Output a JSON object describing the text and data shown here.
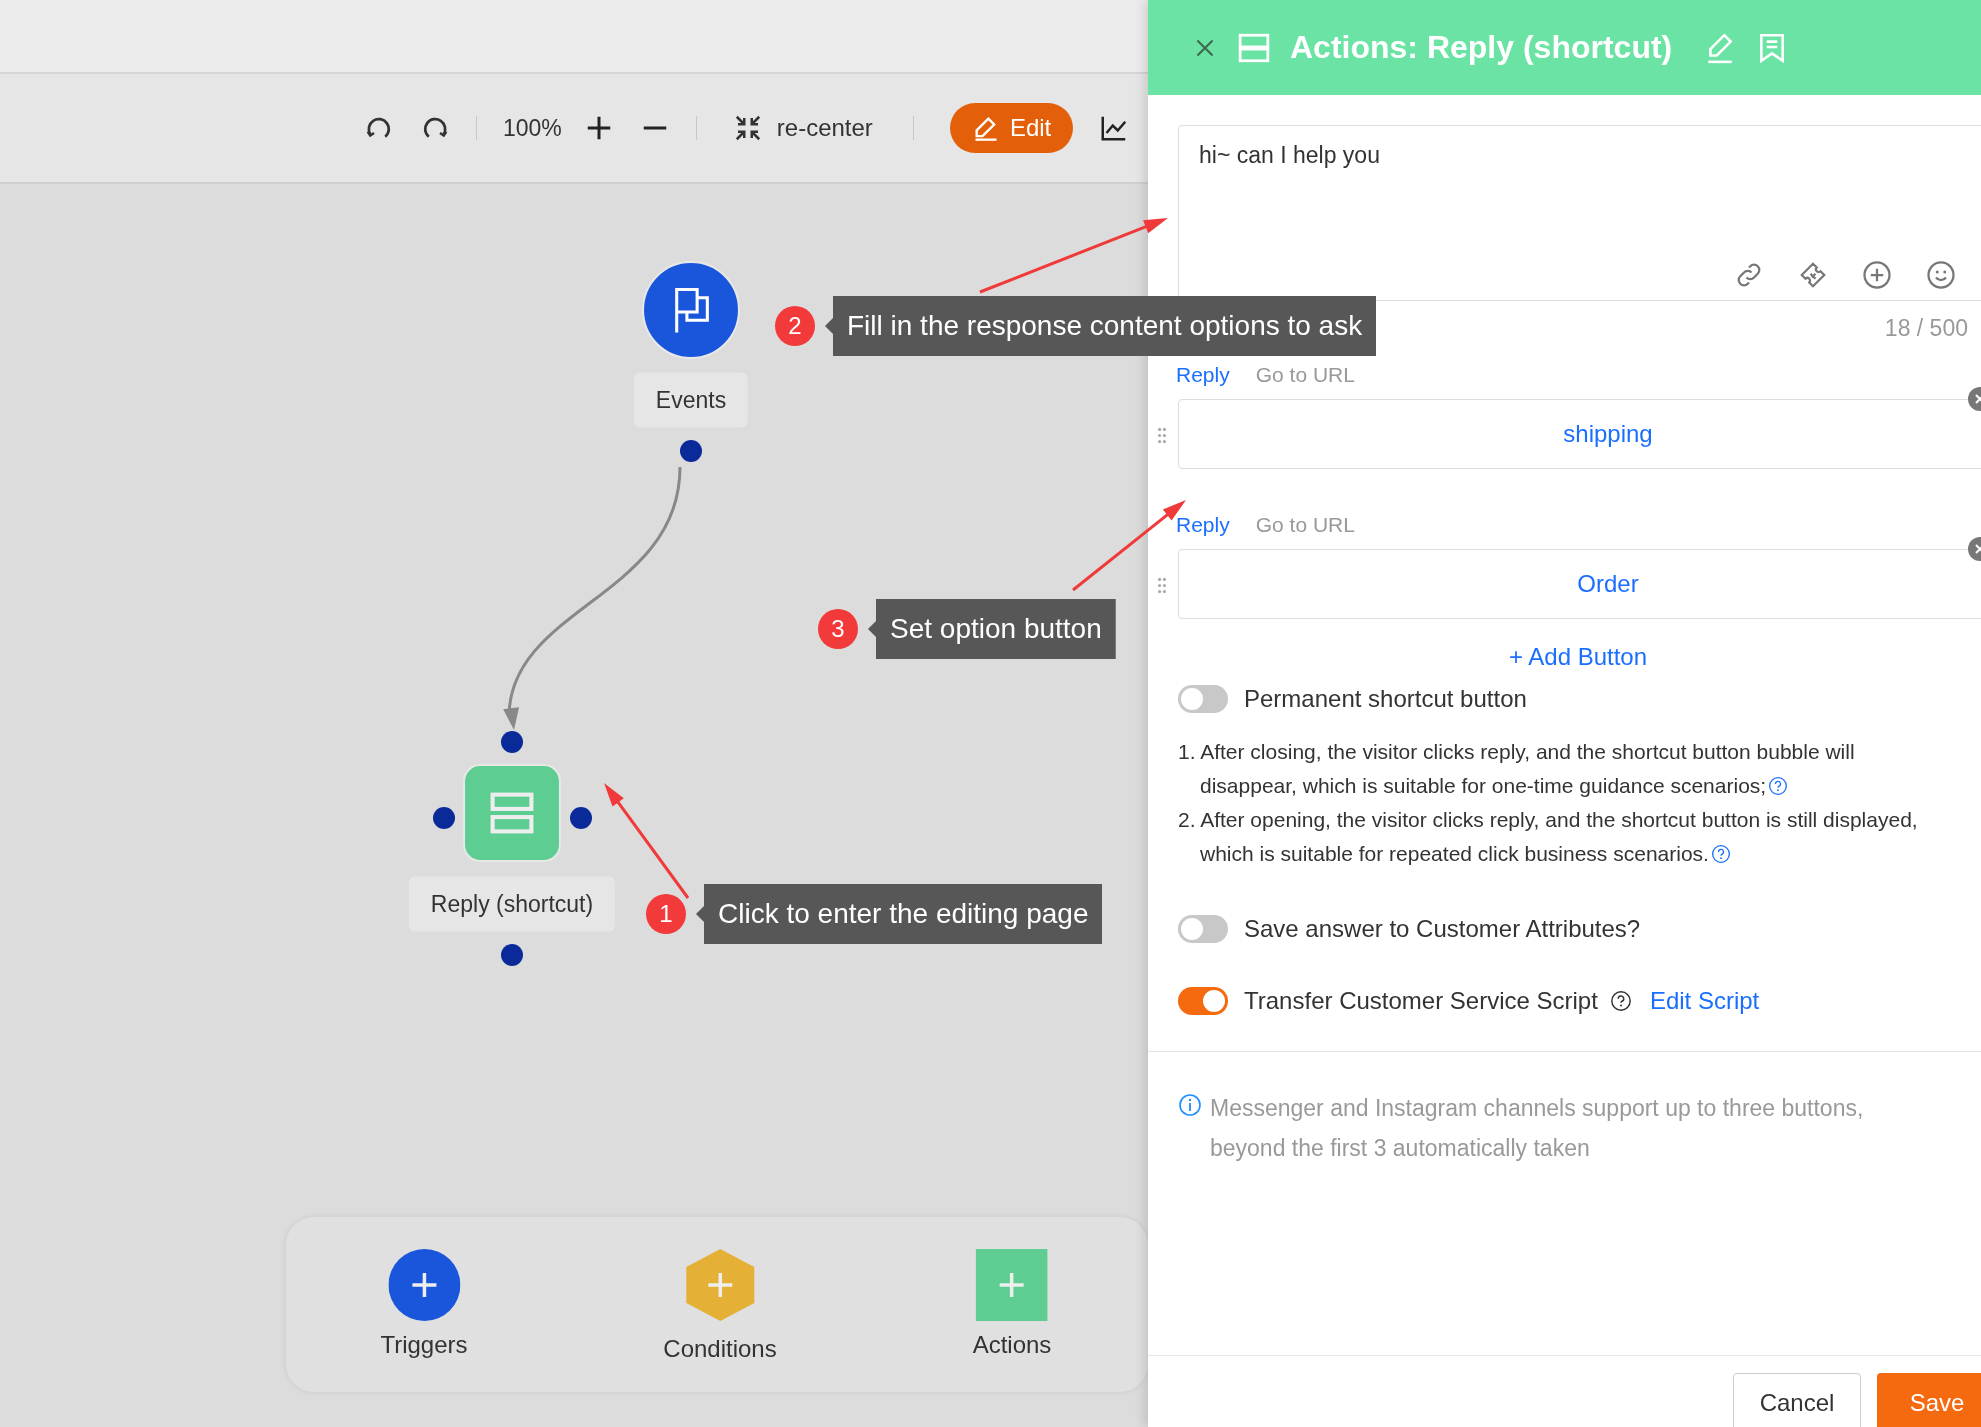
{
  "toolbar": {
    "zoom": "100%",
    "recenter": "re-center",
    "edit": "Edit"
  },
  "nodes": [
    {
      "kind": "trigger",
      "label": "Events"
    },
    {
      "kind": "action",
      "label": "Reply (shortcut)"
    }
  ],
  "annotations": [
    {
      "number": "2",
      "text": "Fill in the response content options to ask"
    },
    {
      "number": "3",
      "text": "Set option button"
    },
    {
      "number": "1",
      "text": "Click to enter the editing page"
    }
  ],
  "palette": [
    {
      "kind": "trigger",
      "label": "Triggers"
    },
    {
      "kind": "condition",
      "label": "Conditions"
    },
    {
      "kind": "action",
      "label": "Actions"
    }
  ],
  "panel": {
    "title": "Actions: Reply (shortcut)",
    "message": "hi~ can I help you",
    "counter": "18 / 500",
    "buttons": [
      {
        "tabs": [
          {
            "label": "Reply",
            "selected": true
          },
          {
            "label": "Go to URL",
            "selected": false
          }
        ],
        "value": "shipping"
      },
      {
        "tabs": [
          {
            "label": "Reply",
            "selected": true
          },
          {
            "label": "Go to URL",
            "selected": false
          }
        ],
        "value": "Order"
      }
    ],
    "add_button": "+ Add Button",
    "settings": [
      {
        "label": "Permanent shortcut button",
        "on": false,
        "notes": [
          "1. After closing, the visitor clicks reply, and the shortcut button bubble will disappear, which is suitable for one-time guidance scenarios;",
          "2. After opening, the visitor clicks reply, and the shortcut button is still displayed, which is suitable for repeated click business scenarios."
        ]
      },
      {
        "label": "Save answer to Customer Attributes?",
        "on": false
      },
      {
        "label": "Transfer Customer Service Script",
        "on": true,
        "help": true,
        "link": "Edit Script"
      }
    ],
    "info": "Messenger and Instagram channels support up to three buttons, beyond the first 3 automatically taken",
    "cancel": "Cancel",
    "save": "Save"
  }
}
